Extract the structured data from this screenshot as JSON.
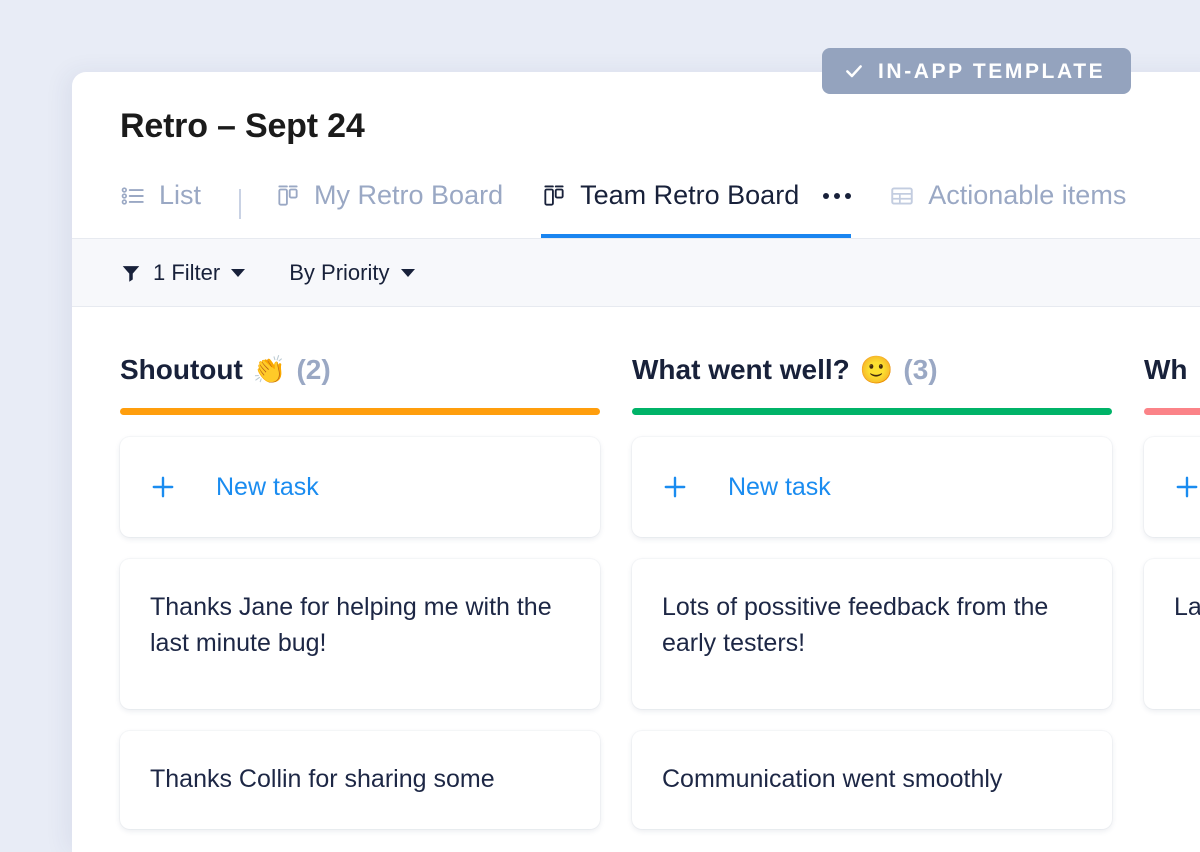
{
  "badge": {
    "label": "IN-APP TEMPLATE",
    "icon": "check-icon",
    "bg_color": "#94a3be",
    "text_color": "#ffffff"
  },
  "header": {
    "title": "Retro – Sept 24"
  },
  "tabs": [
    {
      "label": "List",
      "icon": "list-icon",
      "active": false
    },
    {
      "label": "My Retro Board",
      "icon": "board-icon",
      "active": false
    },
    {
      "label": "Team Retro Board",
      "icon": "board-icon",
      "active": true,
      "menu_icon": "ellipsis-icon"
    },
    {
      "label": "Actionable items",
      "icon": "table-icon",
      "active": false
    }
  ],
  "tab_accent_color": "#1a85f0",
  "toolbar": {
    "filter_icon": "funnel-icon",
    "filter_label": "1 Filter",
    "sort_label": "By Priority",
    "caret_icon": "chevron-down-icon"
  },
  "board": {
    "new_task_label": "New task",
    "new_task_icon": "plus-icon",
    "columns": [
      {
        "title": "Shoutout",
        "emoji": "👏",
        "count": "(2)",
        "bar_color": "#ff9e0d",
        "cards": [
          "Thanks Jane for helping me with the last minute bug!",
          "Thanks Collin for sharing some"
        ]
      },
      {
        "title": "What went well?",
        "emoji": "🙂",
        "count": "(3)",
        "bar_color": "#00b368",
        "cards": [
          "Lots of possitive feedback from the early testers!",
          "Communication went smoothly"
        ]
      },
      {
        "title": "Wh",
        "emoji": "",
        "count": "",
        "bar_color": "#fb8388",
        "cards": [
          "La de",
          ""
        ]
      }
    ]
  },
  "colors": {
    "page_background": "#e8ecf6",
    "panel_background": "#ffffff",
    "toolbar_background": "#f7f8fb",
    "text_primary": "#18213a",
    "text_muted": "#9aa8c4",
    "link_blue": "#1a8cf0"
  }
}
